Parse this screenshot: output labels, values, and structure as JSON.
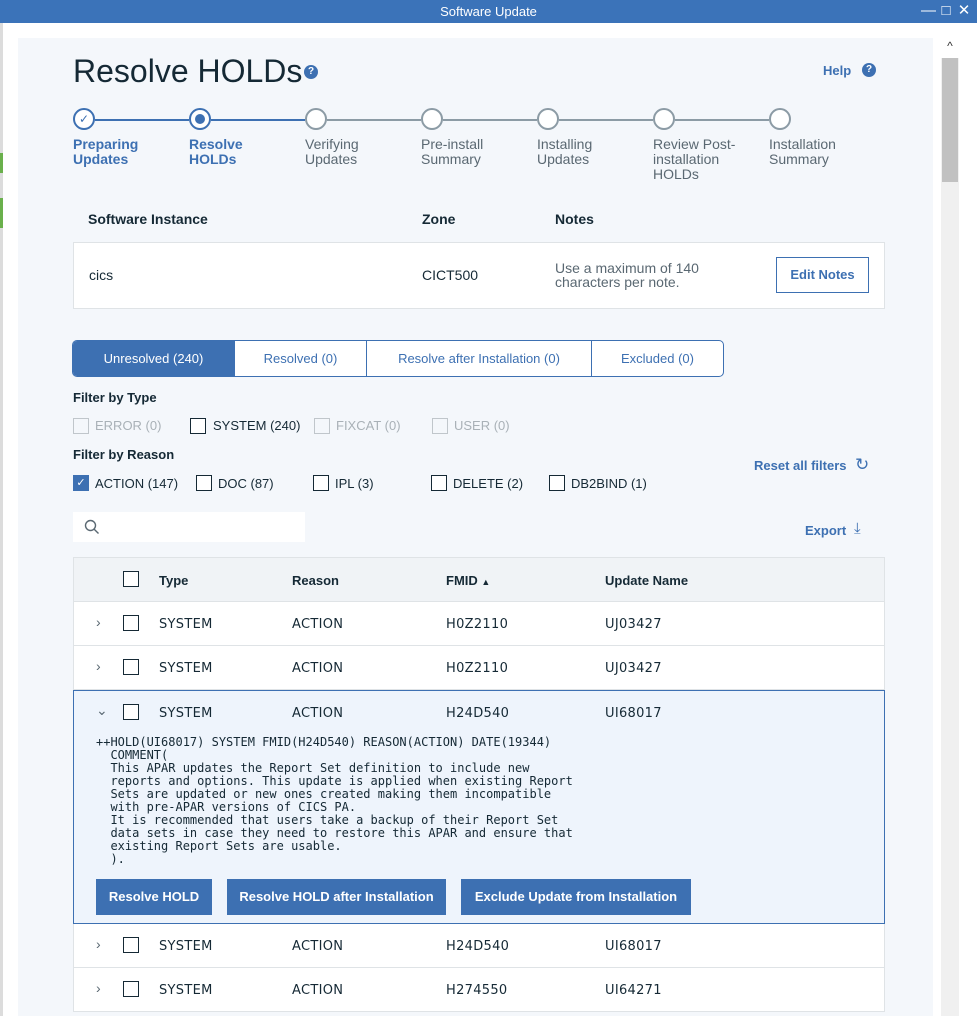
{
  "window": {
    "title": "Software Update",
    "controls": [
      "—",
      "□",
      "✕"
    ]
  },
  "header": {
    "title": "Resolve HOLDs",
    "help_label": "Help"
  },
  "stepper": {
    "steps": [
      {
        "label_l1": "Preparing",
        "label_l2": "Updates",
        "label_l3": "",
        "state": "done"
      },
      {
        "label_l1": "Resolve",
        "label_l2": "HOLDs",
        "label_l3": "",
        "state": "current"
      },
      {
        "label_l1": "Verifying",
        "label_l2": "Updates",
        "label_l3": "",
        "state": "todo"
      },
      {
        "label_l1": "Pre-install",
        "label_l2": "Summary",
        "label_l3": "",
        "state": "todo"
      },
      {
        "label_l1": "Installing",
        "label_l2": "Updates",
        "label_l3": "",
        "state": "todo"
      },
      {
        "label_l1": "Review Post-",
        "label_l2": "installation",
        "label_l3": "HOLDs",
        "state": "todo"
      },
      {
        "label_l1": "Installation",
        "label_l2": "Summary",
        "label_l3": "",
        "state": "todo"
      }
    ]
  },
  "instance": {
    "headers": {
      "software_instance": "Software Instance",
      "zone": "Zone",
      "notes": "Notes"
    },
    "software_instance": "cics",
    "zone": "CICT500",
    "notes_l1": "Use a maximum of 140",
    "notes_l2": "characters per note.",
    "edit_notes_label": "Edit Notes"
  },
  "tabs": [
    {
      "label": "Unresolved (240)",
      "active": true
    },
    {
      "label": "Resolved (0)",
      "active": false
    },
    {
      "label": "Resolve after Installation (0)",
      "active": false
    },
    {
      "label": "Excluded (0)",
      "active": false
    }
  ],
  "filters": {
    "type_title": "Filter by Type",
    "types": [
      {
        "label": "ERROR (0)",
        "checked": false,
        "disabled": true
      },
      {
        "label": "SYSTEM (240)",
        "checked": false,
        "disabled": false
      },
      {
        "label": "FIXCAT (0)",
        "checked": false,
        "disabled": true
      },
      {
        "label": "USER (0)",
        "checked": false,
        "disabled": true
      }
    ],
    "reason_title": "Filter by Reason",
    "reasons": [
      {
        "label": "ACTION (147)",
        "checked": true
      },
      {
        "label": "DOC (87)",
        "checked": false
      },
      {
        "label": "IPL (3)",
        "checked": false
      },
      {
        "label": "DELETE (2)",
        "checked": false
      },
      {
        "label": "DB2BIND (1)",
        "checked": false
      }
    ],
    "reset_label": "Reset all filters"
  },
  "search": {
    "value": "",
    "placeholder": ""
  },
  "export_label": "Export",
  "table": {
    "columns": {
      "type": "Type",
      "reason": "Reason",
      "fmid": "FMID",
      "update": "Update Name"
    },
    "sort_indicator": "▲",
    "rows": [
      {
        "type": "SYSTEM",
        "reason": "ACTION",
        "fmid": "H0Z2110",
        "update": "UJ03427"
      },
      {
        "type": "SYSTEM",
        "reason": "ACTION",
        "fmid": "H0Z2110",
        "update": "UJ03427"
      },
      {
        "type": "SYSTEM",
        "reason": "ACTION",
        "fmid": "H24D540",
        "update": "UI68017"
      },
      {
        "type": "SYSTEM",
        "reason": "ACTION",
        "fmid": "H24D540",
        "update": "UI68017"
      },
      {
        "type": "SYSTEM",
        "reason": "ACTION",
        "fmid": "H274550",
        "update": "UI64271"
      }
    ],
    "expanded": {
      "hold_text": "++HOLD(UI68017) SYSTEM FMID(H24D540) REASON(ACTION) DATE(19344)\n  COMMENT(\n  This APAR updates the Report Set definition to include new\n  reports and options. This update is applied when existing Report\n  Sets are updated or new ones created making them incompatible\n  with pre-APAR versions of CICS PA.\n  It is recommended that users take a backup of their Report Set\n  data sets in case they need to restore this APAR and ensure that\n  existing Report Sets are usable.\n  ).",
      "resolve_label": "Resolve HOLD",
      "resolve_after_label": "Resolve HOLD after Installation",
      "exclude_label": "Exclude Update from Installation"
    }
  }
}
